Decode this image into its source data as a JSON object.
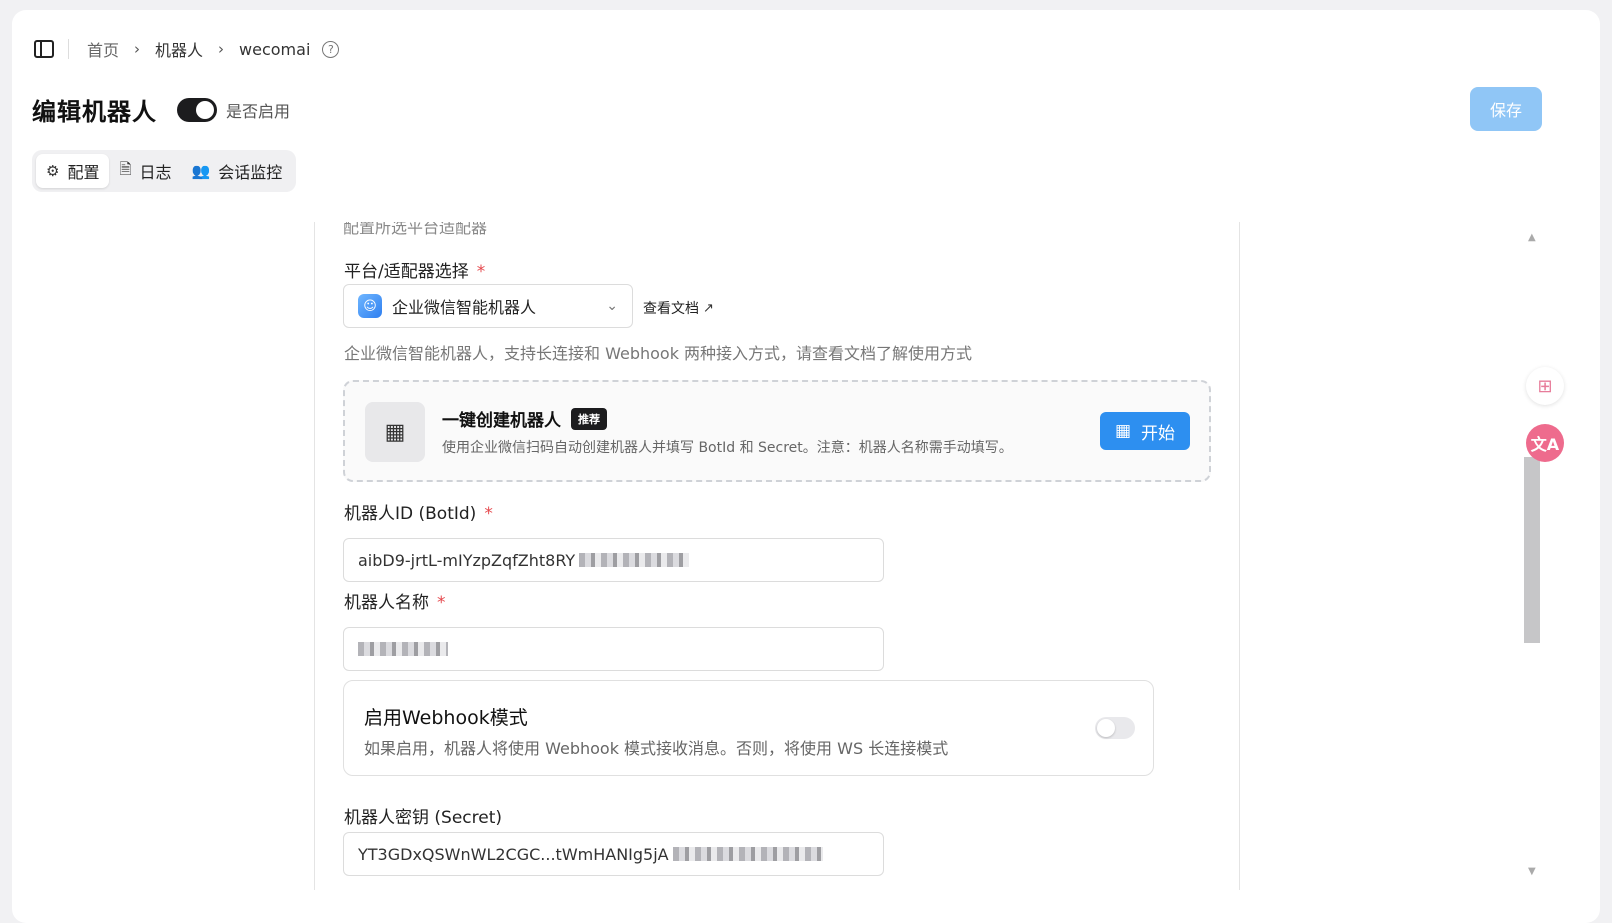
{
  "breadcrumb": {
    "home": "首页",
    "robots": "机器人",
    "current": "wecomai"
  },
  "header": {
    "title": "编辑机器人",
    "enable_label": "是否启用",
    "enabled": true,
    "save_label": "保存"
  },
  "tabs": [
    {
      "label": "配置",
      "icon": "gear-icon",
      "active": true
    },
    {
      "label": "日志",
      "icon": "document-icon",
      "active": false
    },
    {
      "label": "会话监控",
      "icon": "users-icon",
      "active": false
    }
  ],
  "form": {
    "cut_text": "配置所选平台适配器",
    "platform": {
      "label": "平台/适配器选择",
      "required": "*",
      "selected": "企业微信智能机器人",
      "doc_link": "查看文档",
      "hint": "企业微信智能机器人，支持长连接和 Webhook 两种接入方式，请查看文档了解使用方式"
    },
    "quick_create": {
      "title": "一键创建机器人",
      "badge": "推荐",
      "desc": "使用企业微信扫码自动创建机器人并填写 BotId 和 Secret。注意：机器人名称需手动填写。",
      "button": "开始"
    },
    "bot_id": {
      "label": "机器人ID (BotId)",
      "required": "*",
      "value": "aibD9-jrtL-mIYzpZqfZht8RY"
    },
    "bot_name": {
      "label": "机器人名称",
      "required": "*",
      "value": ""
    },
    "webhook": {
      "title": "启用Webhook模式",
      "desc": "如果启用，机器人将使用 Webhook 模式接收消息。否则，将使用 WS 长连接模式",
      "enabled": false
    },
    "secret": {
      "label": "机器人密钥 (Secret)",
      "value": "YT3GDxQSWnWL2CGC...tWmHANIg5jA"
    }
  },
  "colors": {
    "accent": "#2d8ff0",
    "save_disabled": "#90c6f6",
    "required": "#e5484d"
  }
}
